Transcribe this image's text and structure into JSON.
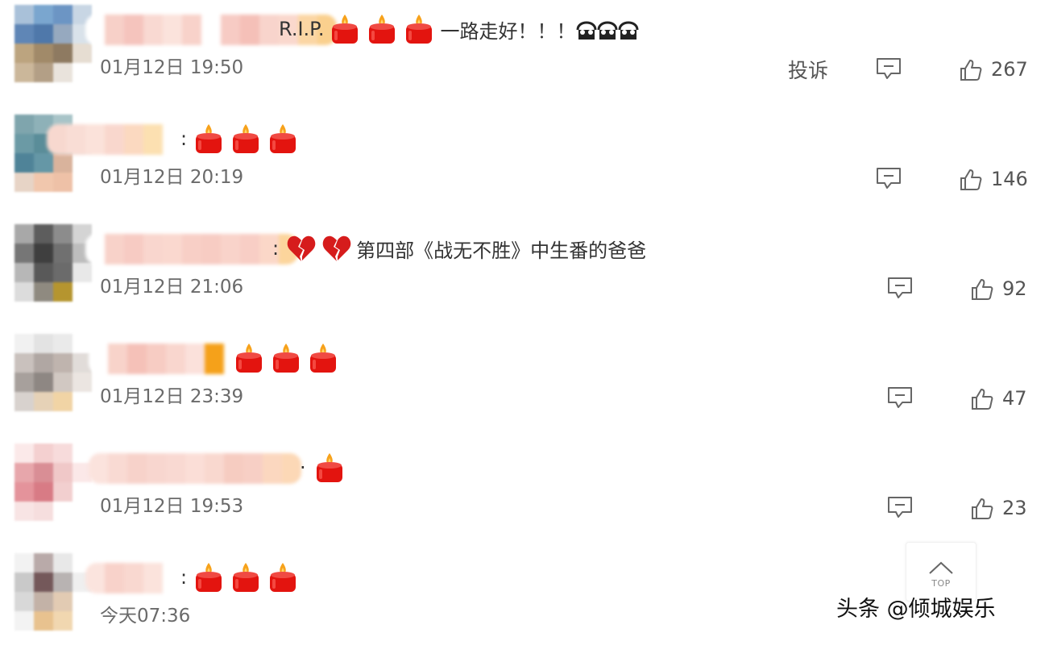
{
  "comments": [
    {
      "prefix": "R.I.P.",
      "candles": 3,
      "hearts": 0,
      "text": "一路走好！！！",
      "crying": true,
      "time": "01月12日 19:50",
      "report": "投诉",
      "likes": "267",
      "avatar": [
        "#a9c1d9",
        "#7aa6cf",
        "#6c95c4",
        "#c8d6e4",
        "#5f86b6",
        "#4f78aa",
        "#96a9bf",
        "#d9e2ea",
        "#bca47f",
        "#a18a69",
        "#8e7a61",
        "#e6ddd2",
        "#cbb79a",
        "#b39f86",
        "#e9e3dc",
        "#ffffff"
      ],
      "uname": [
        "#ffffff",
        "#f7d0c8",
        "#f5c4bd",
        "#f9d9d2",
        "#fbe3dc",
        "#f8d2ca",
        "#ffffff",
        "#f7cbc4",
        "#f5c0b8",
        "#f8d4cc",
        "#fad8cd",
        "#fbd6a4",
        "#fad08e"
      ]
    },
    {
      "prefix": "",
      "candles": 3,
      "hearts": 0,
      "text": "",
      "crying": false,
      "time": "01月12日 20:19",
      "report": "",
      "likes": "146",
      "avatar": [
        "#7fa5ad",
        "#8eb1b8",
        "#a8c4c8",
        "#ffffff",
        "#6b9aa5",
        "#5a8d99",
        "#79a697",
        "#e4ece9",
        "#4f8398",
        "#6597a6",
        "#d9b39c",
        "#ffffff",
        "#e7d4c6",
        "#f1c7ad",
        "#eec1a7",
        "#ffffff"
      ],
      "uname": [
        "#f7d8cf",
        "#f9ddd5",
        "#fbe2da",
        "#f9d7cd",
        "#fbd9c0",
        "#fce0b1",
        "#ffffff"
      ]
    },
    {
      "prefix": "",
      "candles": 0,
      "hearts": 2,
      "text": "第四部《战无不胜》中生番的爸爸",
      "crying": false,
      "time": "01月12日 21:06",
      "report": "",
      "likes": "92",
      "avatar": [
        "#a8a8a8",
        "#5d5d5d",
        "#8c8c8c",
        "#d4d4d4",
        "#767676",
        "#3f3f3f",
        "#707070",
        "#bdbdbd",
        "#b7b7b7",
        "#595959",
        "#6b6b6b",
        "#e8e8e8",
        "#dcdcdc",
        "#8f8a80",
        "#b5952f",
        "#ffffff"
      ],
      "uname": [
        "#ffffff",
        "#f8d2c9",
        "#f7cbc3",
        "#f9d6ce",
        "#fad8cf",
        "#f8cfc6",
        "#f7ccc3",
        "#f9d3ca",
        "#f8cec5",
        "#fbd7c8",
        "#fcd59c"
      ]
    },
    {
      "prefix": "",
      "candles": 3,
      "hearts": 0,
      "text": "",
      "crying": false,
      "time": "01月12日 23:39",
      "report": "",
      "likes": "47",
      "avatar": [
        "#f1f1f1",
        "#e3e3e3",
        "#eaeaea",
        "#ffffff",
        "#c9c1bd",
        "#b0a7a3",
        "#bfb4ae",
        "#e1dcd9",
        "#a7a09c",
        "#8e8783",
        "#d1c8c2",
        "#ebe5e1",
        "#d8d2ce",
        "#e6d2b7",
        "#f1d4a5",
        "#ffffff"
      ],
      "uname": [
        "#ffffff",
        "#f8d3ca",
        "#f5c1b8",
        "#f7ccc3",
        "#f9d6ce",
        "#fbe1db",
        "#f5a11a",
        "#ffffff"
      ]
    },
    {
      "prefix": "",
      "candles": 1,
      "hearts": 0,
      "text": "",
      "crying": false,
      "time": "01月12日 19:53",
      "report": "",
      "likes": "23",
      "avatar": [
        "#fbe9e9",
        "#f4d0d0",
        "#f7dbdb",
        "#ffffff",
        "#e7a6ab",
        "#d98e95",
        "#f0c8c8",
        "#fbe8e8",
        "#e4939b",
        "#d87b85",
        "#f2cfcf",
        "#ffffff",
        "#f8e4e4",
        "#f6dede",
        "#ffffff",
        "#ffffff"
      ],
      "uname": [
        "#fbe3dd",
        "#f9dad3",
        "#f7d2ca",
        "#f8d6cf",
        "#f9d9d2",
        "#fbded7",
        "#f9d8cf",
        "#f6ccc1",
        "#f7cfc5",
        "#fbd7bf",
        "#fcd8b6"
      ]
    },
    {
      "prefix": "",
      "candles": 3,
      "hearts": 0,
      "text": "",
      "crying": false,
      "time": "今天07:36",
      "report": "",
      "likes": "",
      "avatar": [
        "#f2f2f2",
        "#b9aaa9",
        "#e8e8e8",
        "#ffffff",
        "#c9c9c9",
        "#74585a",
        "#b8b3b2",
        "#efefef",
        "#d8d8d8",
        "#c3b2a7",
        "#e2cbb3",
        "#ffffff",
        "#f3f3f3",
        "#e8c28f",
        "#f1d7b0",
        "#ffffff"
      ],
      "uname": [
        "#fbe4de",
        "#f8d2ca",
        "#f9d8d0",
        "#fbe3dc",
        "#ffffff"
      ]
    }
  ],
  "top_button": {
    "label": "TOP"
  },
  "watermark": "头条 @倾城娱乐",
  "colors": {
    "candle_body": "#e3140f",
    "flame": "#f7a21b",
    "heart": "#d61c1c",
    "text": "#333333",
    "meta": "#6a6a6a"
  },
  "icons": {
    "reply": "comment-icon",
    "like": "thumbs-up-icon",
    "top": "chevron-up-icon"
  }
}
